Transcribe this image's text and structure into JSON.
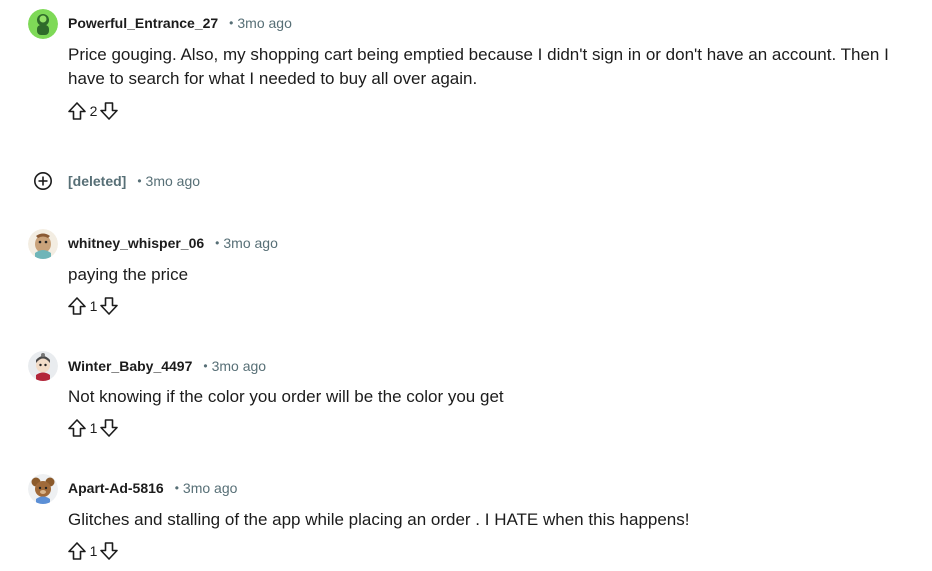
{
  "separator": "•",
  "comments": [
    {
      "username": "Powerful_Entrance_27",
      "time": "3mo ago",
      "body": "Price gouging. Also, my shopping cart being emptied because I didn't sign in or don't have an account. Then I have to search for what I needed to buy all over again.",
      "score": "2",
      "avatar_color": "#7ed957"
    },
    {
      "username": "[deleted]",
      "time": "3mo ago",
      "collapsed": true
    },
    {
      "username": "whitney_whisper_06",
      "time": "3mo ago",
      "body": "paying the price",
      "score": "1"
    },
    {
      "username": "Winter_Baby_4497",
      "time": "3mo ago",
      "body": "Not knowing if the color you order will be the color you get",
      "score": "1"
    },
    {
      "username": "Apart-Ad-5816",
      "time": "3mo ago",
      "body": "Glitches and stalling of the app while placing an order . I HATE when this happens!",
      "score": "1"
    }
  ],
  "icons": {
    "upvote": "upvote-arrow-icon",
    "downvote": "downvote-arrow-icon",
    "expand": "plus-circle-icon"
  },
  "colors": {
    "text": "#1c1c1c",
    "meta": "#576f76"
  }
}
